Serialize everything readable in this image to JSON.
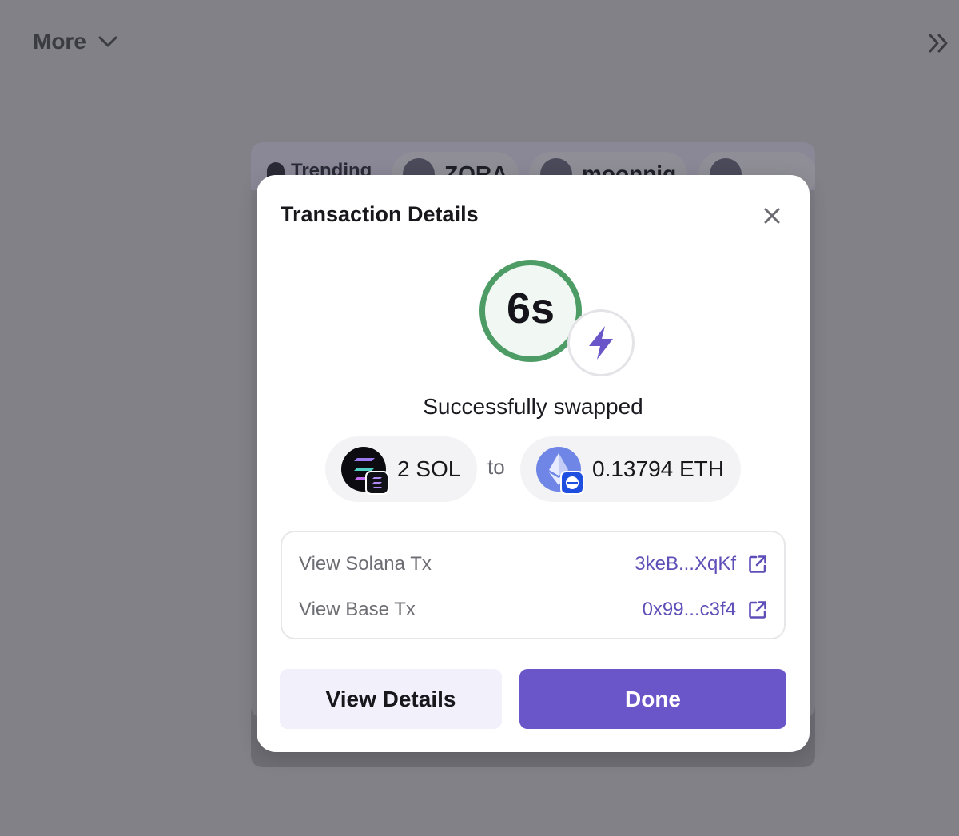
{
  "topbar": {
    "more_label": "More"
  },
  "background": {
    "trending_label": "Trending",
    "pills": [
      "ZORA",
      "moonpig"
    ]
  },
  "modal": {
    "title": "Transaction Details",
    "timer": "6s",
    "status": "Successfully swapped",
    "from_token": {
      "amount": "2 SOL"
    },
    "connector": "to",
    "to_token": {
      "amount": "0.13794 ETH"
    },
    "tx": [
      {
        "label": "View Solana Tx",
        "hash": "3keB...XqKf"
      },
      {
        "label": "View Base Tx",
        "hash": "0x99...c3f4"
      }
    ],
    "buttons": {
      "details": "View Details",
      "done": "Done"
    }
  },
  "colors": {
    "accent": "#6b56c9",
    "timer_ring": "#4e9c65",
    "link": "#5e4fb8"
  },
  "icons": [
    "chevron-down-icon",
    "double-chevron-right-icon",
    "close-icon",
    "lightning-bolt-icon",
    "solana-icon",
    "ethereum-icon",
    "external-link-icon"
  ]
}
